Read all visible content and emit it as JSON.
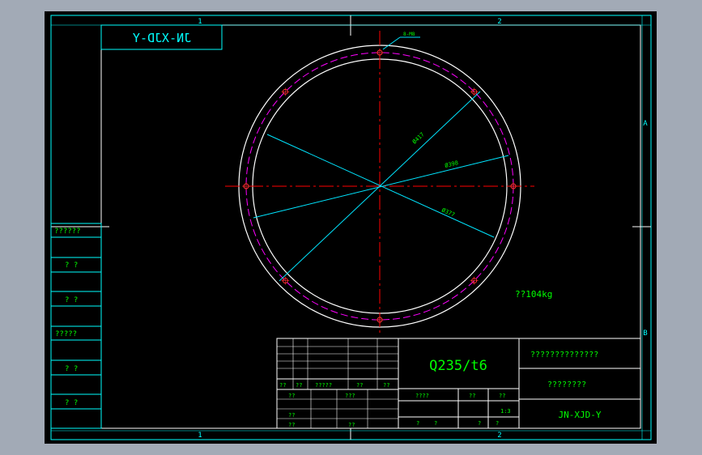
{
  "colors": {
    "background": "#000000",
    "frame": "#00ffff",
    "border": "#ffffff",
    "text": "#00ff00",
    "centerline": "#ff0000",
    "dimension": "#00e5ff",
    "bolt_circle": "#ff00ff",
    "ui_gray": "#a2aab6"
  },
  "frame": {
    "zone_top_left": "1",
    "zone_top_right": "2",
    "zone_bottom_left": "1",
    "zone_bottom_right": "2",
    "zone_right_top": "A",
    "zone_right_bottom": "B"
  },
  "corner_label": "JN-XJD-Y",
  "drawing": {
    "hole_callout": "8-M8",
    "dim_outer": "Ø417",
    "dim_middle": "Ø398",
    "dim_inner": "Ø377",
    "weight": "??104kg"
  },
  "left_panel": {
    "rows": [
      "??????",
      "? ?",
      "? ?",
      "?????",
      "? ?",
      "? ?"
    ]
  },
  "title_block": {
    "material": "Q235/t6",
    "title_line1": "??????????????",
    "title_line2": "????????",
    "drawing_number": "JN-XJD-Y",
    "scale": "1:3",
    "sig_row": [
      "??",
      "??",
      "?????",
      "??",
      "??"
    ],
    "left_labels": [
      "??",
      "???",
      "??",
      "??",
      "??"
    ],
    "mid_row_headers": [
      "????",
      "??",
      "??"
    ],
    "bottom_row": [
      "?",
      "?",
      "?",
      "?"
    ]
  }
}
